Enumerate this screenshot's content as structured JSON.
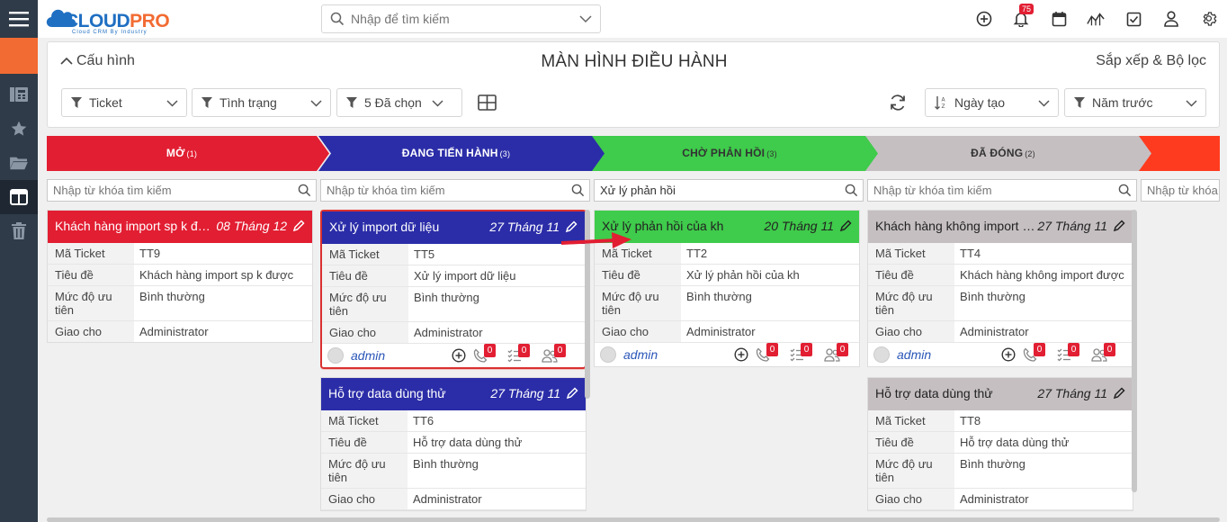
{
  "app": {
    "logo_cloud": "CLOUD",
    "logo_pro": "PRO",
    "logo_sub": "Cloud CRM By Industry"
  },
  "search": {
    "placeholder": "Nhập để tìm kiếm"
  },
  "topbar": {
    "notification_count": "75"
  },
  "header": {
    "config_label": "Cấu hình",
    "title": "MÀN HÌNH ĐIỀU HÀNH",
    "sort_filter_label": "Sắp xếp & Bộ lọc"
  },
  "filters": {
    "module": "Ticket",
    "status": "Tình trạng",
    "selected": "5 Đã chọn",
    "sort": "Ngày tạo",
    "period": "Năm trước"
  },
  "colors": {
    "open": "#e21e32",
    "in_progress": "#2b2da8",
    "waiting": "#3fcb4b",
    "closed": "#c5bfc2",
    "next": "#ff3b1f"
  },
  "stages": [
    {
      "label": "MỞ",
      "count": "(1)"
    },
    {
      "label": "ĐANG TIẾN HÀNH",
      "count": "(3)"
    },
    {
      "label": "CHỜ PHẢN HỒI",
      "count": "(3)"
    },
    {
      "label": "ĐÃ ĐÓNG",
      "count": "(2)"
    }
  ],
  "column_search": [
    {
      "value": "",
      "placeholder": "Nhập từ khóa tìm kiếm"
    },
    {
      "value": "",
      "placeholder": "Nhập từ khóa tìm kiếm"
    },
    {
      "value": "Xử lý phản hồi",
      "placeholder": "Nhập từ khóa tìm kiếm"
    },
    {
      "value": "",
      "placeholder": "Nhập từ khóa tìm kiếm"
    },
    {
      "value": "",
      "placeholder": "Nhập từ khóa"
    }
  ],
  "field_labels": {
    "ticket_no": "Mã Ticket",
    "title": "Tiêu đề",
    "priority": "Mức độ ưu tiên",
    "assigned": "Giao cho"
  },
  "columns": [
    {
      "cards": [
        {
          "header": "Khách hàng import sp k được",
          "date": "08 Tháng 12",
          "ticket": "TT9",
          "title": "Khách hàng import sp k được",
          "priority": "Bình thường",
          "assigned": "Administrator",
          "owner": "",
          "counts": []
        }
      ]
    },
    {
      "cards": [
        {
          "header": "Xử lý import dữ liệu",
          "date": "27 Tháng 11",
          "ticket": "TT5",
          "title": "Xử lý import dữ liệu",
          "priority": "Bình thường",
          "assigned": "Administrator",
          "owner": "admin",
          "counts": [
            "0",
            "0",
            "0"
          ]
        },
        {
          "header": "Hỗ trợ data dùng thử",
          "date": "27 Tháng 11",
          "ticket": "TT6",
          "title": "Hỗ trợ data dùng thử",
          "priority": "Bình thường",
          "assigned": "Administrator",
          "owner": "",
          "counts": []
        }
      ]
    },
    {
      "cards": [
        {
          "header": "Xử lý phản hồi của kh",
          "date": "20 Tháng 11",
          "ticket": "TT2",
          "title": "Xử lý phản hồi của kh",
          "priority": "Bình thường",
          "assigned": "Administrator",
          "owner": "admin",
          "counts": [
            "0",
            "0",
            "0"
          ]
        }
      ]
    },
    {
      "cards": [
        {
          "header": "Khách hàng không import được",
          "date": "27 Tháng 11",
          "ticket": "TT4",
          "title": "Khách hàng không import được",
          "priority": "Bình thường",
          "assigned": "Administrator",
          "owner": "admin",
          "counts": [
            "0",
            "0",
            "0"
          ]
        },
        {
          "header": "Hỗ trợ data dùng thử",
          "date": "27 Tháng 11",
          "ticket": "TT8",
          "title": "Hỗ trợ data dùng thử",
          "priority": "Bình thường",
          "assigned": "Administrator",
          "owner": "",
          "counts": []
        }
      ]
    }
  ],
  "first_card_footer_owner": "admin"
}
